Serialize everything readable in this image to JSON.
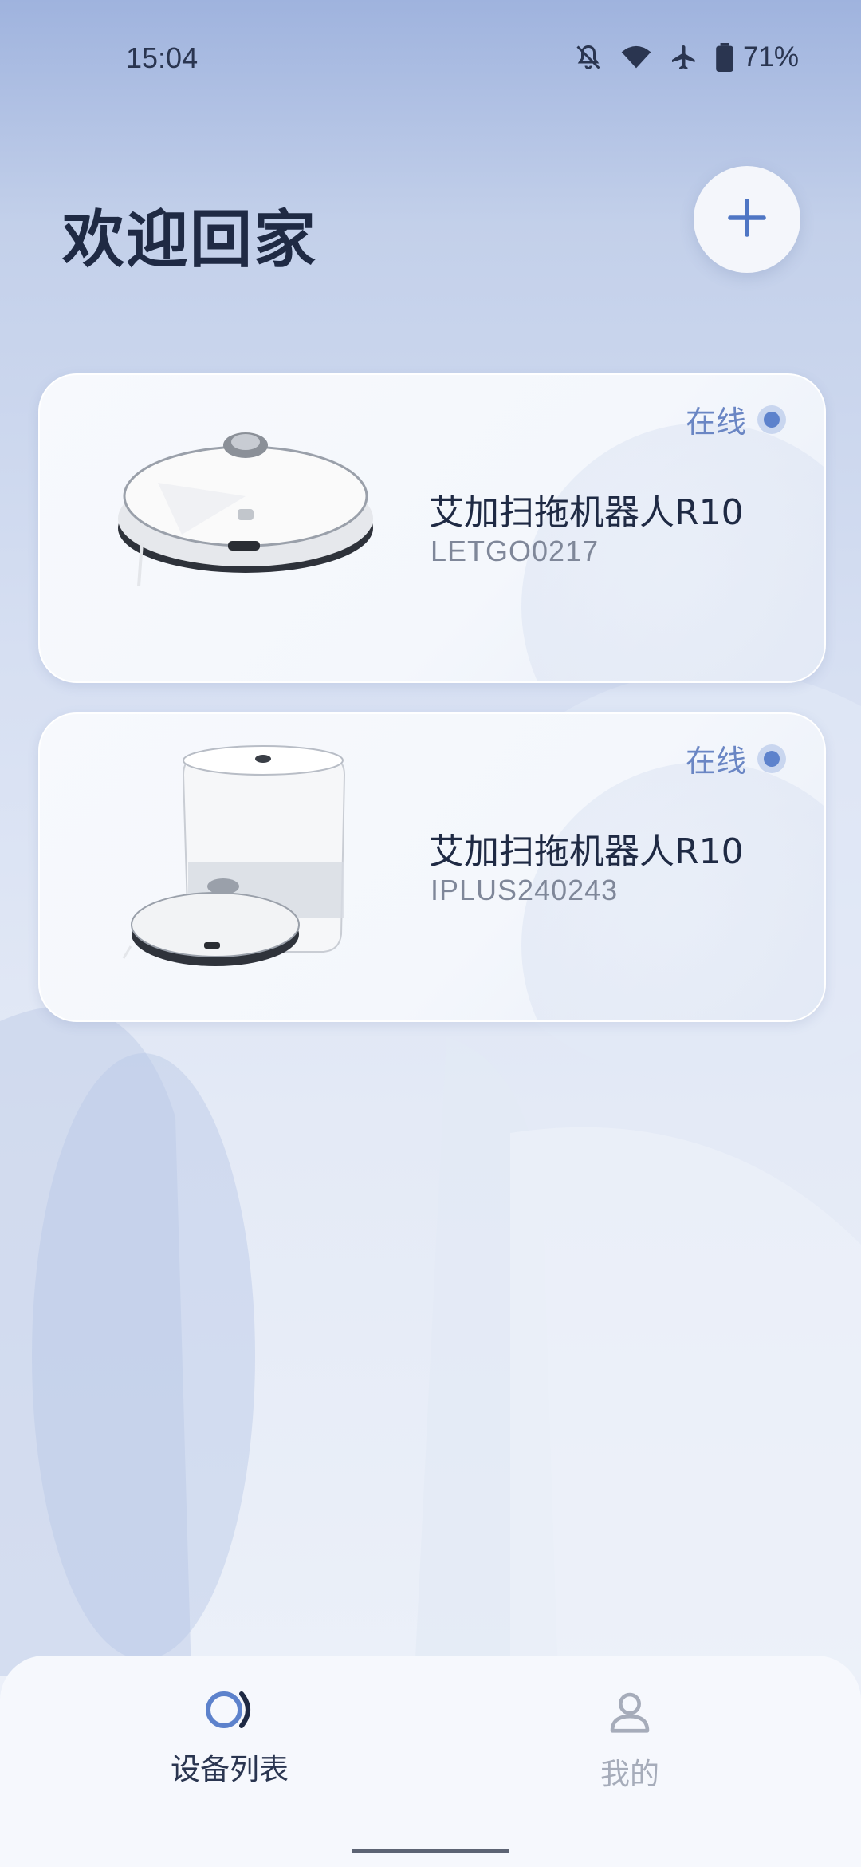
{
  "status_bar": {
    "time": "15:04",
    "battery_percent": "71%",
    "icons": [
      "bell-off-icon",
      "wifi-icon",
      "airplane-icon",
      "battery-icon"
    ]
  },
  "header": {
    "title": "欢迎回家",
    "add_icon": "plus-icon"
  },
  "devices": [
    {
      "status": "在线",
      "name": "艾加扫拖机器人R10",
      "serial": "LETGO0217",
      "image": "robot-vacuum"
    },
    {
      "status": "在线",
      "name": "艾加扫拖机器人R10",
      "serial": "IPLUS240243",
      "image": "robot-vacuum-with-dock"
    }
  ],
  "bottom_nav": {
    "items": [
      {
        "label": "设备列表",
        "icon": "device-list-icon",
        "active": true
      },
      {
        "label": "我的",
        "icon": "user-icon",
        "active": false
      }
    ]
  },
  "colors": {
    "accent": "#5d82cc",
    "title": "#1f2a44",
    "muted": "#7f8799"
  }
}
